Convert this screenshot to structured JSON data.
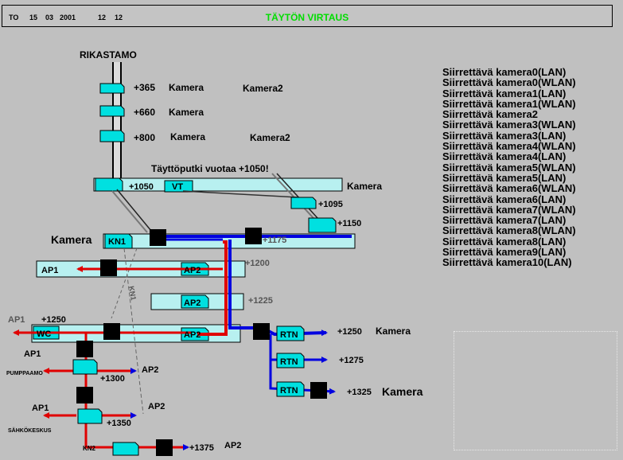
{
  "header": {
    "day": "TO",
    "date_d": "15",
    "date_m": "03",
    "date_y": "2001",
    "time_h": "12",
    "time_m": "12",
    "title": "TÄYTÖN VIRTAUS"
  },
  "labels": {
    "rikastamo": "RIKASTAMO",
    "l365": "+365",
    "l660": "+660",
    "l800": "+800",
    "cam_a": "Kamera",
    "cam_b": "Kamera",
    "cam_c": "Kamera",
    "cam2_a": "Kamera2",
    "cam2_b": "Kamera2",
    "leak": "Täyttöputki vuotaa +1050!",
    "l1050": "+1050",
    "vt": "VT",
    "cam_1050": "Kamera",
    "l1095": "+1095",
    "l1150": "+1150",
    "cam_kn1": "Kamera",
    "kn1": "KN1",
    "l1175": "+1175",
    "ap1_1200": "AP1",
    "ap2_1200": "AP2",
    "l1200": "+1200",
    "ap2_1225": "AP2",
    "l1225": "+1225",
    "ap1_1250": "AP1",
    "l1250": "+1250",
    "wc": "WC",
    "ap2_1250": "AP2",
    "kn1_vert": "KN1",
    "rtn1": "RTN",
    "l1250_r": "+1250",
    "cam_1250": "Kamera",
    "rtn2": "RTN",
    "l1275": "+1275",
    "rtn3": "RTN",
    "l1325": "+1325",
    "cam_1325": "Kamera",
    "ap1_pump": "AP1",
    "pumppaamo": "PUMPPAAMO",
    "l1300": "+1300",
    "ap2_pump": "AP2",
    "ap1_sah": "AP1",
    "sahkokeskus": "SÄHKÖKESKUS",
    "l1350": "+1350",
    "ap2_sah": "AP2",
    "kn2": "KN2",
    "l1375": "+1375",
    "ap2_1375": "AP2"
  },
  "cameras": [
    "Siirrettävä kamera0(LAN)",
    "Siirrettävä kamera0(WLAN)",
    "Siirrettävä kamera1(LAN)",
    "Siirrettävä kamera1(WLAN)",
    "Siirrettävä kamera2",
    "Siirrettävä kamera3(WLAN)",
    "Siirrettävä kamera3(LAN)",
    "Siirrettävä kamera4(WLAN)",
    "Siirrettävä kamera4(LAN)",
    "Siirrettävä kamera5(WLAN)",
    "Siirrettävä kamera5(LAN)",
    "Siirrettävä kamera6(WLAN)",
    "Siirrettävä kamera6(LAN)",
    "Siirrettävä kamera7(WLAN)",
    "Siirrettävä kamera7(LAN)",
    "Siirrettävä kamera8(WLAN)",
    "Siirrettävä kamera8(LAN)",
    "Siirrettävä kamera9(LAN)",
    "Siirrettävä kamera10(LAN)"
  ],
  "colors": {
    "pipe_red": "#e00000",
    "pipe_blue": "#0000e0",
    "tank": "#00e0e0",
    "level": "#b8f0f0",
    "title": "#00dd00"
  }
}
